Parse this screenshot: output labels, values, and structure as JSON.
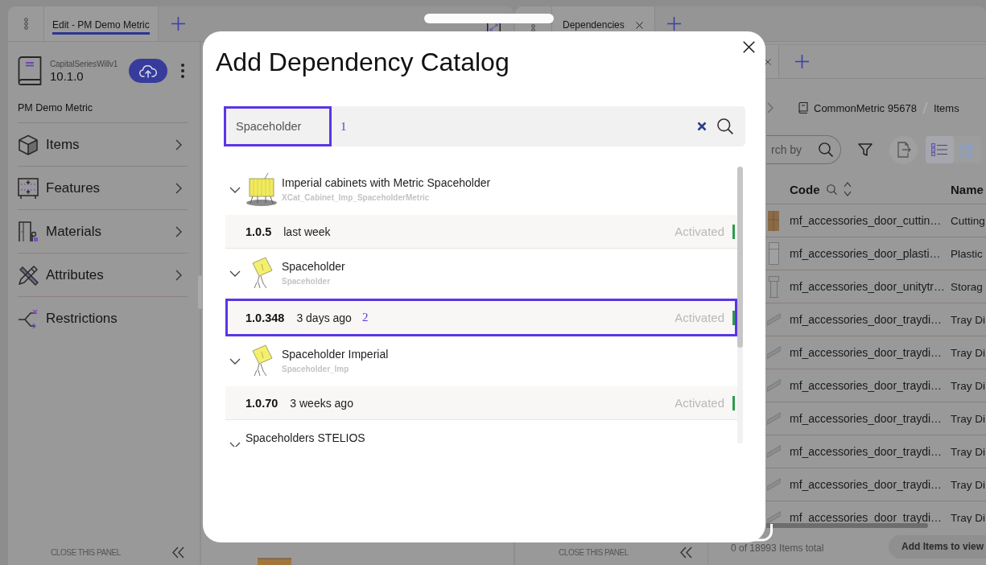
{
  "left_panel": {
    "tabs": [
      {
        "label": "Edit - PM Demo Metric",
        "selected": true
      }
    ],
    "catalog": {
      "name": "CapitalSeriesWillv1",
      "version": "10.1.0"
    },
    "title": "PM Demo Metric",
    "nav": [
      {
        "label": "Items",
        "kind": "submenu"
      },
      {
        "label": "Features",
        "kind": "submenu"
      },
      {
        "label": "Materials",
        "kind": "submenu"
      },
      {
        "label": "Attributes",
        "kind": "submenu"
      },
      {
        "label": "Restrictions",
        "kind": "link"
      }
    ],
    "footer": "CLOSE THIS PANEL"
  },
  "right_panel": {
    "tabs": [
      {
        "label": "Dependencies"
      }
    ],
    "footer": "CLOSE THIS PANEL",
    "breadcrumb": [
      "CommonMetric 95678",
      "Items"
    ],
    "search": {
      "placeholder": "rch by"
    },
    "view_modes": [
      {
        "kind": "list",
        "selected": true
      },
      {
        "kind": "grid",
        "selected": false
      }
    ],
    "table": {
      "columns": [
        "Code",
        "Name"
      ],
      "rows": [
        {
          "code": "mf_accessories_door_cuttin…",
          "name": "Cutting"
        },
        {
          "code": "mf_accessories_door_plasti…",
          "name": "Plastic"
        },
        {
          "code": "mf_accessories_door_unitytr…",
          "name": "Storag"
        },
        {
          "code": "mf_accessories_door_traydi…",
          "name": "Tray Di"
        },
        {
          "code": "mf_accessories_door_traydi…",
          "name": "Tray Di"
        },
        {
          "code": "mf_accessories_door_traydi…",
          "name": "Tray Di"
        },
        {
          "code": "mf_accessories_door_traydi…",
          "name": "Tray Di"
        },
        {
          "code": "mf_accessories_door_traydi…",
          "name": "Tray Di"
        },
        {
          "code": "mf_accessories_door_traydi…",
          "name": "Tray Di"
        },
        {
          "code": "mf_accessories_door_traydi…",
          "name": "Tray Di"
        }
      ]
    },
    "total": "0 of 18993 Items total",
    "add_button": "Add Items to view"
  },
  "dialog": {
    "title": "Add Dependency Catalog",
    "search": {
      "value": "Spaceholder",
      "annotation": "1"
    },
    "catalogs": [
      {
        "name": "Imperial cabinets with Metric Spaceholder",
        "code": "XCat_Cabinet_Imp_SpaceholderMetric",
        "image": true,
        "expanded": true,
        "versions": [
          {
            "version": "1.0.5",
            "date": "last week",
            "status": "Activated",
            "active": true
          }
        ]
      },
      {
        "name": "Spaceholder",
        "code": "Spaceholder",
        "image": true,
        "expanded": true,
        "versions": [
          {
            "version": "1.0.348",
            "date": "3 days ago",
            "status": "Activated",
            "active": true,
            "annotation": "2"
          }
        ]
      },
      {
        "name": "Spaceholder Imperial",
        "code": "Spaceholder_Imp",
        "image": true,
        "expanded": true,
        "versions": [
          {
            "version": "1.0.70",
            "date": "3 weeks ago",
            "status": "Activated",
            "active": true
          }
        ]
      },
      {
        "name": "Spaceholders STELIOS",
        "image": false,
        "expanded": true
      }
    ]
  }
}
